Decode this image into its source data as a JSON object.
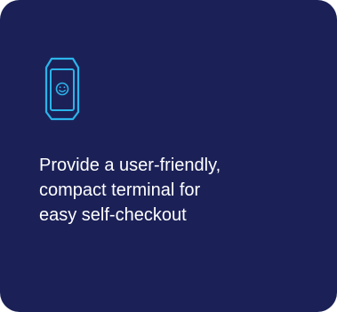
{
  "card": {
    "icon": "smiley-terminal-icon",
    "text": "Provide a user-friendly,\ncompact terminal for\neasy self-checkout"
  },
  "colors": {
    "background": "#1b2157",
    "icon_stroke": "#2bb4ea",
    "text": "#ffffff"
  }
}
